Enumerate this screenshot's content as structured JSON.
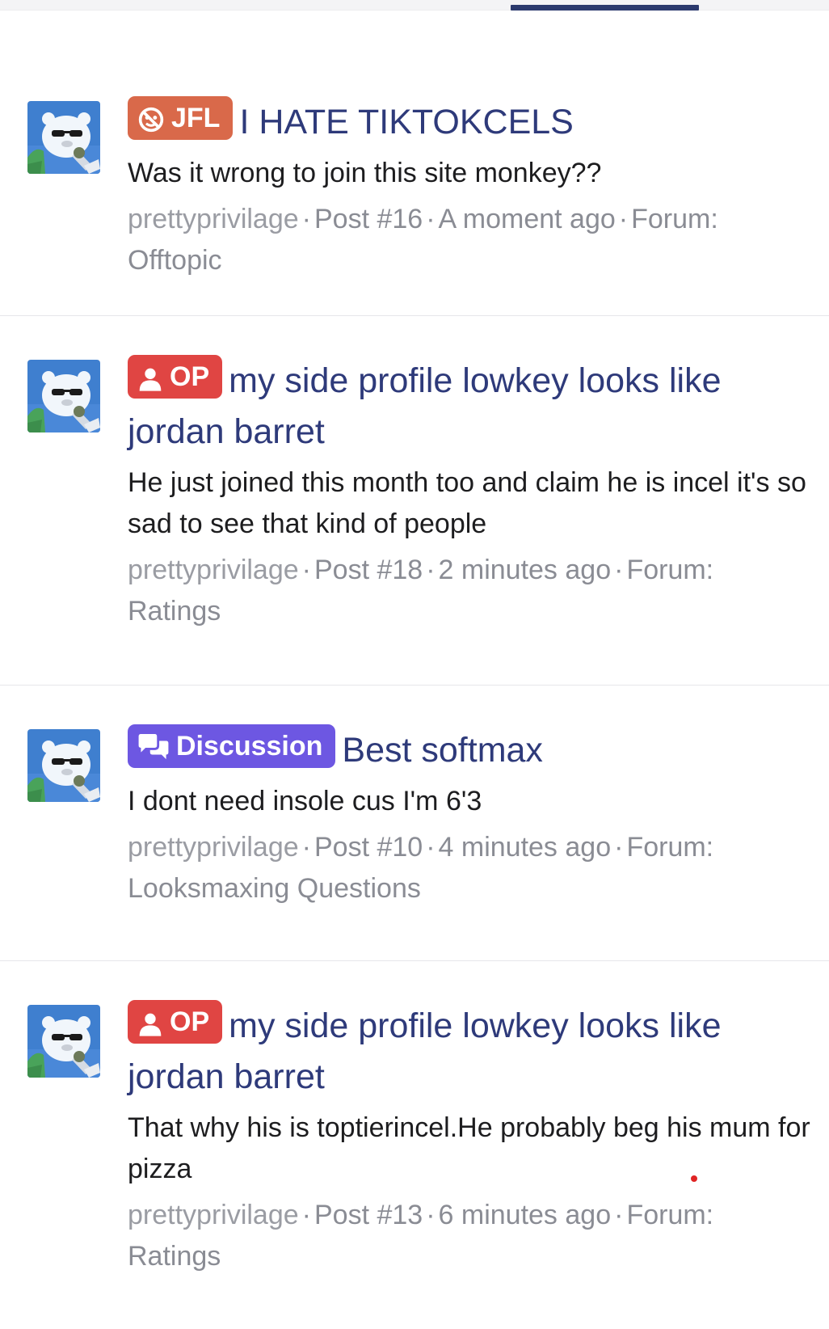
{
  "posts": [
    {
      "badge": "JFL",
      "badge_icon": "fire-smile-icon",
      "badge_color": "#d9694a",
      "title": "I HATE TIKTOKCELS",
      "snippet": "Was it wrong to join this site monkey??",
      "author": "prettyprivilage",
      "post_number": "Post #16",
      "time": "A moment ago",
      "forum_label": "Forum:",
      "forum": "Offtopic"
    },
    {
      "badge": "OP",
      "badge_icon": "user-icon",
      "badge_color": "#e04543",
      "title": "my side profile lowkey looks like jordan barret",
      "snippet": "He just joined this month too and claim he is incel it's so sad to see that kind of people",
      "author": "prettyprivilage",
      "post_number": "Post #18",
      "time": "2 minutes ago",
      "forum_label": "Forum:",
      "forum": "Ratings"
    },
    {
      "badge": "Discussion",
      "badge_icon": "chat-bubbles-icon",
      "badge_color": "#6d57e2",
      "title": "Best softmax",
      "snippet": "I dont need insole cus I'm 6'3",
      "author": "prettyprivilage",
      "post_number": "Post #10",
      "time": "4 minutes ago",
      "forum_label": "Forum:",
      "forum": "Looksmaxing Questions"
    },
    {
      "badge": "OP",
      "badge_icon": "user-icon",
      "badge_color": "#e04543",
      "title": "my side profile lowkey looks like jordan barret",
      "snippet": "That why his is toptierincel.He probably beg his mum for pizza",
      "author": "prettyprivilage",
      "post_number": "Post #13",
      "time": "6 minutes ago",
      "forum_label": "Forum:",
      "forum": "Ratings"
    }
  ],
  "separator": "·",
  "colors": {
    "title": "#2e3a7a",
    "meta": "#8a8c94",
    "tab_indicator": "#2c3a6e"
  }
}
